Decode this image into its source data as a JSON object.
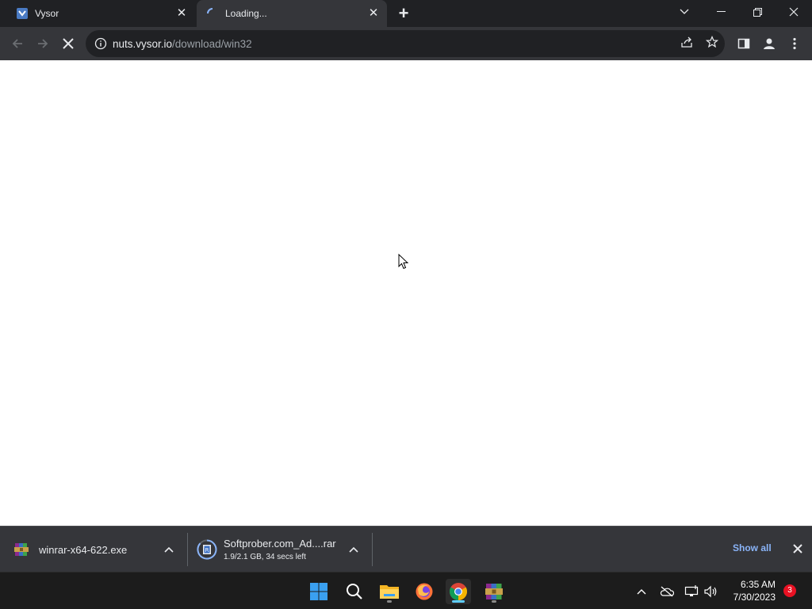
{
  "browser": {
    "tabs": [
      {
        "title": "Vysor",
        "favicon": "vysor-icon",
        "active": false
      },
      {
        "title": "Loading...",
        "favicon": "loading-spinner-icon",
        "active": true
      }
    ],
    "address": {
      "host": "nuts.vysor.io",
      "path": "/download/win32"
    }
  },
  "downloads": {
    "items": [
      {
        "filename": "winrar-x64-622.exe",
        "status": "",
        "icon": "winrar-icon"
      },
      {
        "filename": "Softprober.com_Ad....rar",
        "status": "1.9/2.1 GB, 34 secs left",
        "icon": "archive-progress-icon"
      }
    ],
    "show_all_label": "Show all"
  },
  "taskbar": {
    "apps": [
      "start-icon",
      "search-icon",
      "file-explorer-icon",
      "firefox-icon",
      "chrome-icon",
      "winrar-icon"
    ],
    "clock": {
      "time": "6:35 AM",
      "date": "7/30/2023"
    },
    "notification_count": "3"
  },
  "colors": {
    "tab_bg": "#202124",
    "toolbar_bg": "#35363a",
    "link_blue": "#8ab4f8",
    "badge_red": "#e81123"
  }
}
